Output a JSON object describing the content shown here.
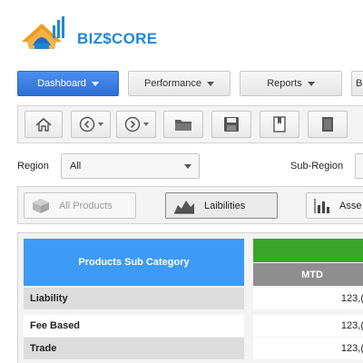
{
  "logo": {
    "text": "BIZ$CORE",
    "icon": "house-chart-logo"
  },
  "nav": {
    "items": [
      {
        "label": "Dashboard",
        "active": true
      },
      {
        "label": "Performance",
        "active": false
      },
      {
        "label": "Reports",
        "active": false
      },
      {
        "label": "B",
        "active": false
      }
    ]
  },
  "toolbar": {
    "buttons": [
      "home-icon",
      "back-icon",
      "forward-icon",
      "folder-icon",
      "save-icon",
      "bookmark-icon",
      "document-icon"
    ]
  },
  "filters": {
    "region_label": "Region",
    "region_value": "All",
    "subregion_label": "Sub-Region"
  },
  "product_tabs": [
    {
      "label": "All Products",
      "state": "disabled"
    },
    {
      "label": "Laibilities",
      "state": "selected"
    },
    {
      "label": "Asse",
      "state": "normal"
    }
  ],
  "table": {
    "header_category": "Products Sub Category",
    "header_period": "MTD",
    "rows": [
      {
        "name": "Liability",
        "value": "123,("
      },
      {
        "name": "Fee Based",
        "value": "123,("
      },
      {
        "name": "Trade",
        "value": "123,("
      }
    ]
  },
  "colors": {
    "nav_active": "#3a7fe6",
    "table_header_blue": "#3d9af5",
    "table_header_green": "#3aa52a",
    "table_subheader_gray": "#8e8e8e",
    "logo_orange": "#f39a1e",
    "logo_blue": "#1e88d6"
  }
}
